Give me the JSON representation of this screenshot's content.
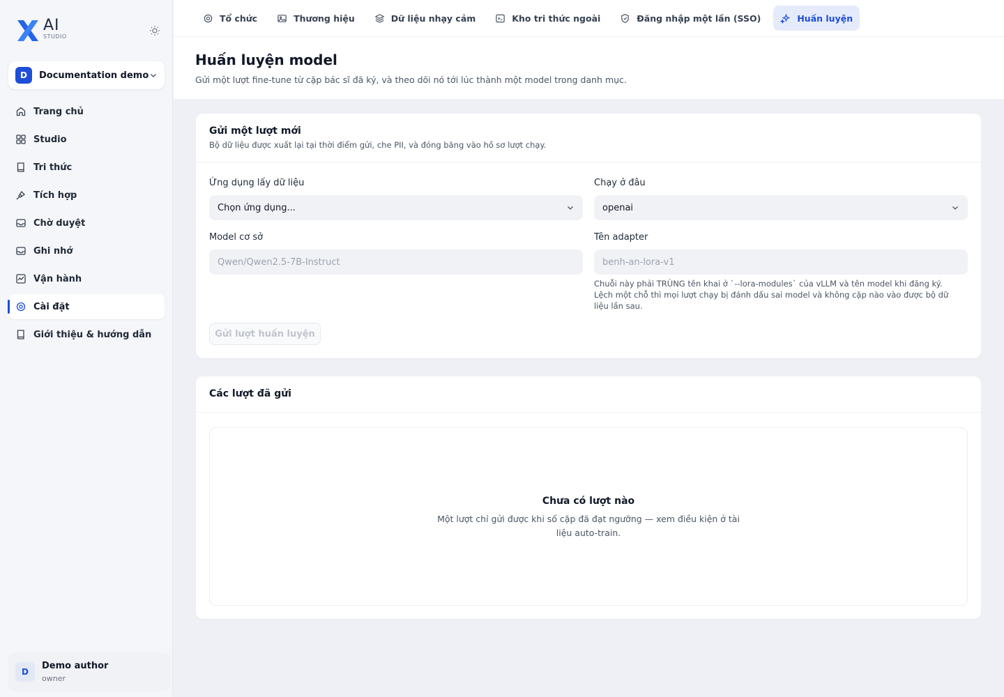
{
  "brand": {
    "logo_text": "AI",
    "logo_sub": "STUDIO"
  },
  "workspace": {
    "badge": "D",
    "name": "Documentation demo"
  },
  "sidebar": {
    "items": [
      {
        "label": "Trang chủ",
        "icon": "home-icon"
      },
      {
        "label": "Studio",
        "icon": "grid-icon"
      },
      {
        "label": "Tri thức",
        "icon": "book-icon"
      },
      {
        "label": "Tích hợp",
        "icon": "plug-icon"
      },
      {
        "label": "Chờ duyệt",
        "icon": "inbox-icon"
      },
      {
        "label": "Ghi nhớ",
        "icon": "memory-icon"
      },
      {
        "label": "Vận hành",
        "icon": "activity-icon"
      },
      {
        "label": "Cài đặt",
        "icon": "gear-icon",
        "active": true
      },
      {
        "label": "Giới thiệu & hướng dẫn",
        "icon": "book-icon"
      }
    ]
  },
  "user": {
    "initial": "D",
    "name": "Demo author",
    "role": "owner"
  },
  "tabs": [
    {
      "label": "Tổ chức",
      "icon": "gear-icon"
    },
    {
      "label": "Thương hiệu",
      "icon": "image-icon"
    },
    {
      "label": "Dữ liệu nhạy cảm",
      "icon": "layers-icon"
    },
    {
      "label": "Kho tri thức ngoài",
      "icon": "terminal-icon"
    },
    {
      "label": "Đăng nhập một lần (SSO)",
      "icon": "shield-icon"
    },
    {
      "label": "Huấn luyện",
      "icon": "sparkle-icon",
      "active": true
    }
  ],
  "page": {
    "title": "Huấn luyện model",
    "subtitle": "Gửi một lượt fine-tune từ cặp bác sĩ đã ký, và theo dõi nó tới lúc thành một model trong danh mục."
  },
  "form": {
    "title": "Gửi một lượt mới",
    "description": "Bộ dữ liệu được xuất lại tại thời điểm gửi, che PII, và đóng băng vào hồ sơ lượt chạy.",
    "app_label": "Ứng dụng lấy dữ liệu",
    "app_value": "Chọn ứng dụng...",
    "runner_label": "Chạy ở đâu",
    "runner_value": "openai",
    "model_label": "Model cơ sở",
    "model_placeholder": "Qwen/Qwen2.5-7B-Instruct",
    "adapter_label": "Tên adapter",
    "adapter_placeholder": "benh-an-lora-v1",
    "adapter_hint": "Chuỗi này phải TRÙNG tên khai ở `--lora-modules` của vLLM và tên model khi đăng ký. Lệch một chỗ thì mọi lượt chạy bị đánh dấu sai model và không cặp nào vào được bộ dữ liệu lần sau.",
    "submit_label": "Gửi lượt huấn luyện"
  },
  "runs": {
    "title": "Các lượt đã gửi",
    "empty_title": "Chưa có lượt nào",
    "empty_desc": "Một lượt chỉ gửi được khi số cặp đã đạt ngưỡng — xem điều kiện ở tài liệu auto-train."
  },
  "colors": {
    "accent": "#1d4ed8",
    "tab_active_bg": "#e6ebfb",
    "bg": "#eef0f5"
  }
}
